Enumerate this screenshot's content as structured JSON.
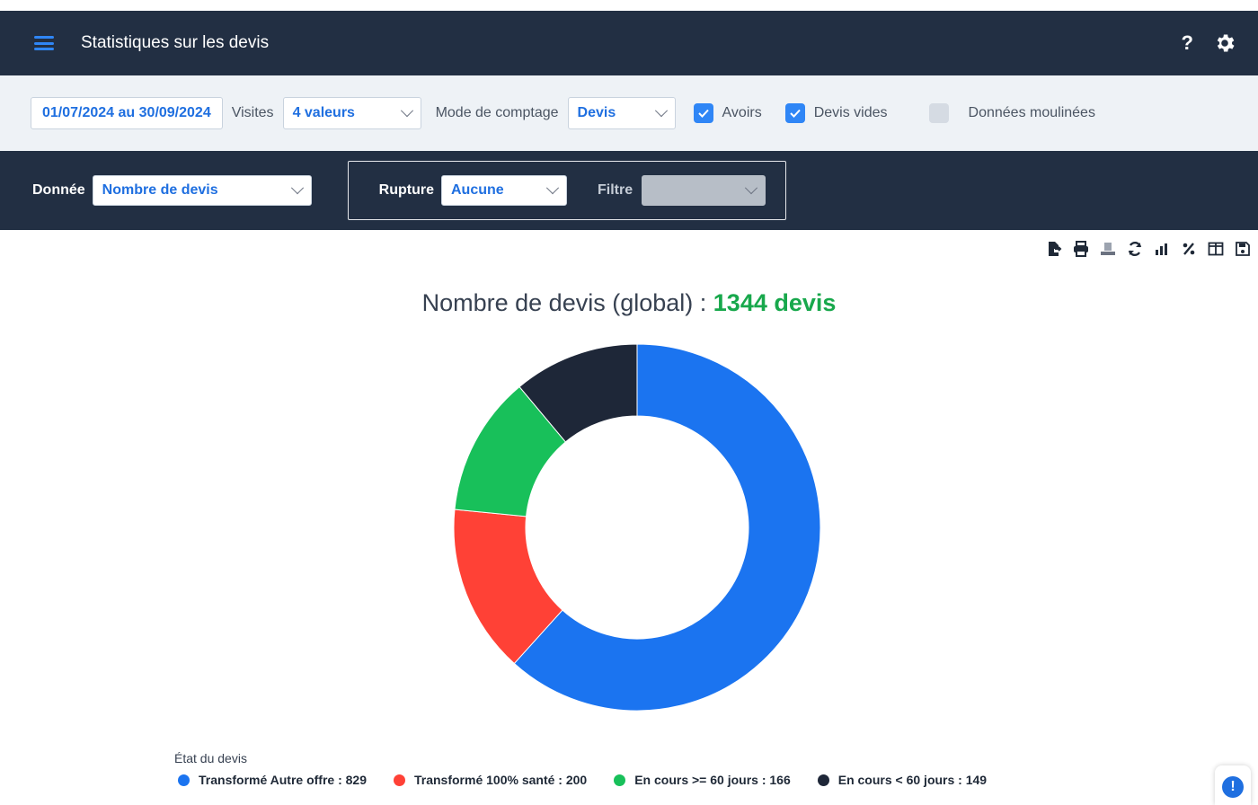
{
  "header": {
    "title": "Statistiques sur les devis",
    "help": "?"
  },
  "filters": {
    "date_range": "01/07/2024 au 30/09/2024",
    "visites_label": "Visites",
    "visites_value": "4 valeurs",
    "mode_label": "Mode de comptage",
    "mode_value": "Devis",
    "avoirs_label": "Avoirs",
    "avoirs_checked": true,
    "devis_vides_label": "Devis vides",
    "devis_vides_checked": true,
    "moulinees_label": "Données moulinées",
    "moulinees_checked": false
  },
  "dimensions": {
    "donnee_label": "Donnée",
    "donnee_value": "Nombre de devis",
    "rupture_label": "Rupture",
    "rupture_value": "Aucune",
    "filtre_label": "Filtre",
    "filtre_value": ""
  },
  "toolbar": {
    "icons": [
      "export-icon",
      "print-icon",
      "currency-icon",
      "refresh-icon",
      "bar-chart-icon",
      "percent-icon",
      "columns-icon",
      "save-icon"
    ]
  },
  "chart": {
    "title_prefix": "Nombre de devis (global) :",
    "title_value": "1344 devis",
    "legend_title": "État du devis",
    "legend_items": [
      "Transformé Autre offre : 829",
      "Transformé 100% santé : 200",
      "En cours >= 60 jours : 166",
      "En cours < 60 jours : 149"
    ]
  },
  "colors": {
    "blue": "#1b74f0",
    "red": "#ff4136",
    "green": "#18c05a",
    "navy": "#1e2738",
    "total": "#18a84c"
  },
  "chart_data": {
    "type": "pie",
    "title": "Nombre de devis (global) : 1344 devis",
    "legend_title": "État du devis",
    "categories": [
      "Transformé Autre offre",
      "Transformé 100% santé",
      "En cours >= 60 jours",
      "En cours < 60 jours"
    ],
    "values": [
      829,
      200,
      166,
      149
    ],
    "colors": [
      "#1b74f0",
      "#ff4136",
      "#18c05a",
      "#1e2738"
    ],
    "donut": true,
    "legend_position": "bottom"
  }
}
